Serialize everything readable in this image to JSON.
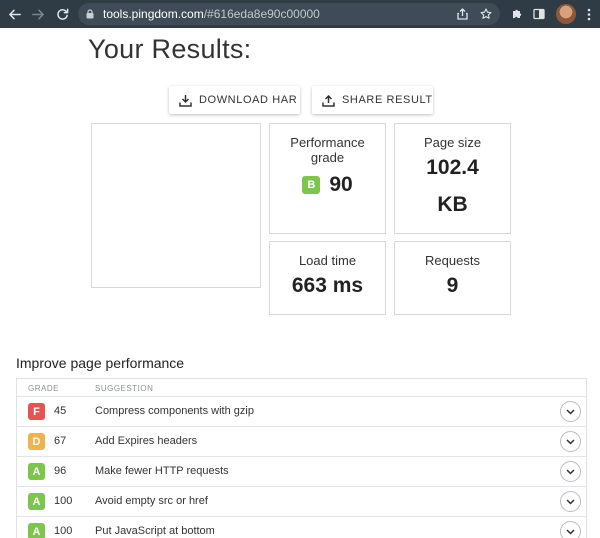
{
  "browser": {
    "url_host": "tools.pingdom.com",
    "url_path": "/#616eda8e90c00000"
  },
  "page": {
    "title": "Your Results:",
    "download_label": "DOWNLOAD HAR",
    "share_label": "SHARE RESULT"
  },
  "metrics": {
    "performance": {
      "label": "Performance grade",
      "grade": "B",
      "grade_color": "#7cc64b",
      "value": "90"
    },
    "page_size": {
      "label": "Page size",
      "value": "102.4",
      "unit": "KB"
    },
    "load_time": {
      "label": "Load time",
      "value": "663 ms"
    },
    "requests": {
      "label": "Requests",
      "value": "9"
    }
  },
  "improve": {
    "title": "Improve page performance",
    "headers": {
      "grade": "GRADE",
      "suggestion": "SUGGESTION"
    },
    "rows": [
      {
        "grade": "F",
        "color": "#e55353",
        "score": "45",
        "suggestion": "Compress components with gzip"
      },
      {
        "grade": "D",
        "color": "#f0b34c",
        "score": "67",
        "suggestion": "Add Expires headers"
      },
      {
        "grade": "A",
        "color": "#7cc64b",
        "score": "96",
        "suggestion": "Make fewer HTTP requests"
      },
      {
        "grade": "A",
        "color": "#7cc64b",
        "score": "100",
        "suggestion": "Avoid empty src or href"
      },
      {
        "grade": "A",
        "color": "#7cc64b",
        "score": "100",
        "suggestion": "Put JavaScript at bottom"
      }
    ]
  }
}
